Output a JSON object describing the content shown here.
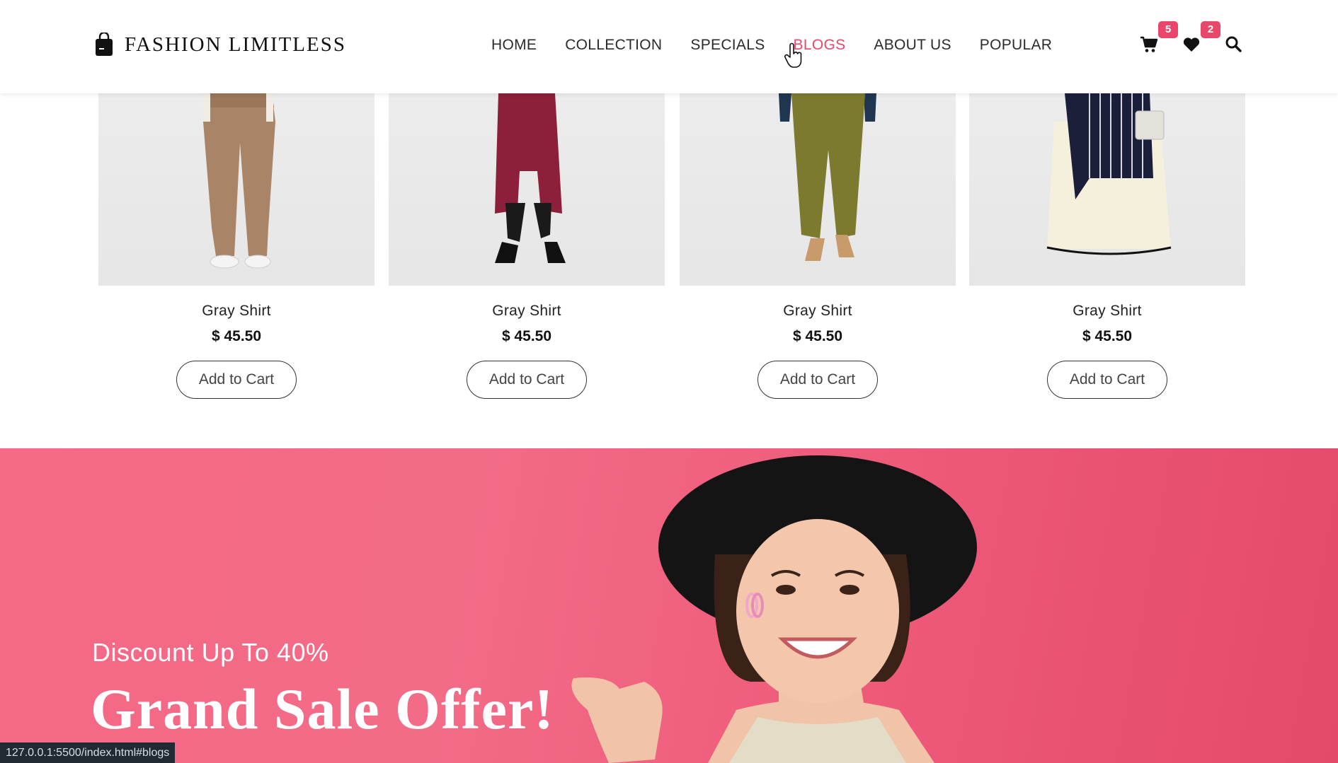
{
  "brand": {
    "name": "FASHION LIMITLESS",
    "icon": "shopping-bag-icon"
  },
  "nav": {
    "items": [
      {
        "label": "HOME",
        "active": false
      },
      {
        "label": "COLLECTION",
        "active": false
      },
      {
        "label": "SPECIALS",
        "active": false
      },
      {
        "label": "BLOGS",
        "active": true
      },
      {
        "label": "ABOUT US",
        "active": false
      },
      {
        "label": "POPULAR",
        "active": false
      }
    ]
  },
  "header_icons": {
    "cart": {
      "icon": "cart-icon",
      "count": "5"
    },
    "wishlist": {
      "icon": "heart-icon",
      "count": "2"
    },
    "search": {
      "icon": "search-icon"
    }
  },
  "products": [
    {
      "title": "Gray Shirt",
      "price": "$ 45.50",
      "button": "Add to Cart"
    },
    {
      "title": "Gray Shirt",
      "price": "$ 45.50",
      "button": "Add to Cart"
    },
    {
      "title": "Gray Shirt",
      "price": "$ 45.50",
      "button": "Add to Cart"
    },
    {
      "title": "Gray Shirt",
      "price": "$ 45.50",
      "button": "Add to Cart"
    }
  ],
  "banner": {
    "subtitle": "Discount Up To 40%",
    "title": "Grand Sale Offer!"
  },
  "status_bar": {
    "url": "127.0.0.1:5500/index.html#blogs"
  },
  "colors": {
    "accent": "#e8476b",
    "banner": "#f26b87",
    "text": "#222222"
  }
}
